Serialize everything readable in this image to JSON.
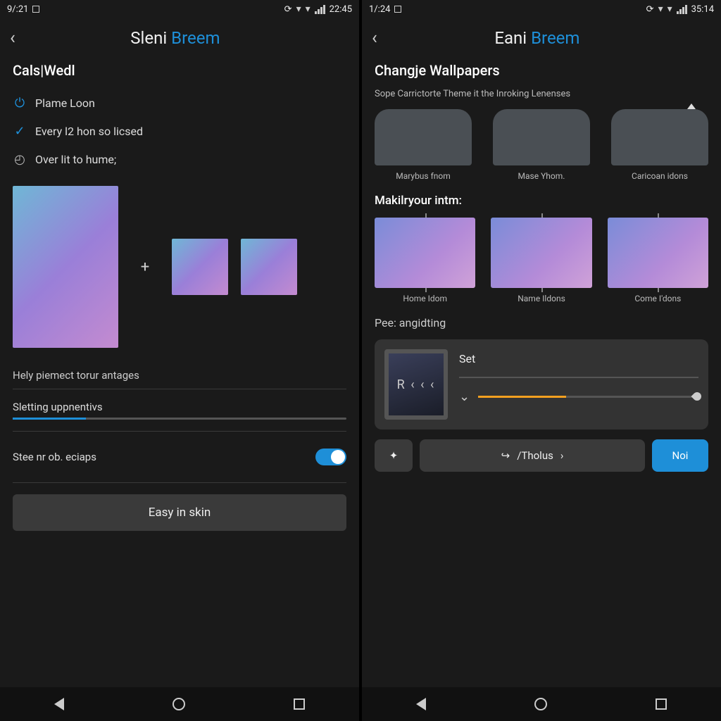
{
  "left": {
    "status": {
      "time_left": "9/:21",
      "time_right": "22:45"
    },
    "header_word1": "Sleni",
    "header_word2": "Breem",
    "section": "Cals|Wedl",
    "opt1": "Plame Loon",
    "opt2": "Every l2 hon so licsed",
    "opt3": "Over lit to hume;",
    "hint": "Hely piemect torur antages",
    "progress_label": "Sletting uppnentivs",
    "toggle_label": "Stee nr ob. eciaps",
    "button": "Easy in skin"
  },
  "right": {
    "status": {
      "time_left": "1/:24",
      "time_right": "35:14"
    },
    "header_word1": "Eani",
    "header_word2": "Breem",
    "section": "Changje Wallpapers",
    "subtitle": "Sope Carrictorte Theme it the Inroking Lenenses",
    "themes": [
      "Marybus fnom",
      "Mase Yhom.",
      "Caricoan idons"
    ],
    "make_title": "Makilryour intm:",
    "grads": [
      "Home Idom",
      "Name Ildons",
      "Come I'dons"
    ],
    "pee_title": "Pee: angidting",
    "card_thumb_text": "R ‹ ‹ ‹",
    "card_set": "Set",
    "btn_mid": "/Tholus",
    "btn_primary": "Noi"
  }
}
